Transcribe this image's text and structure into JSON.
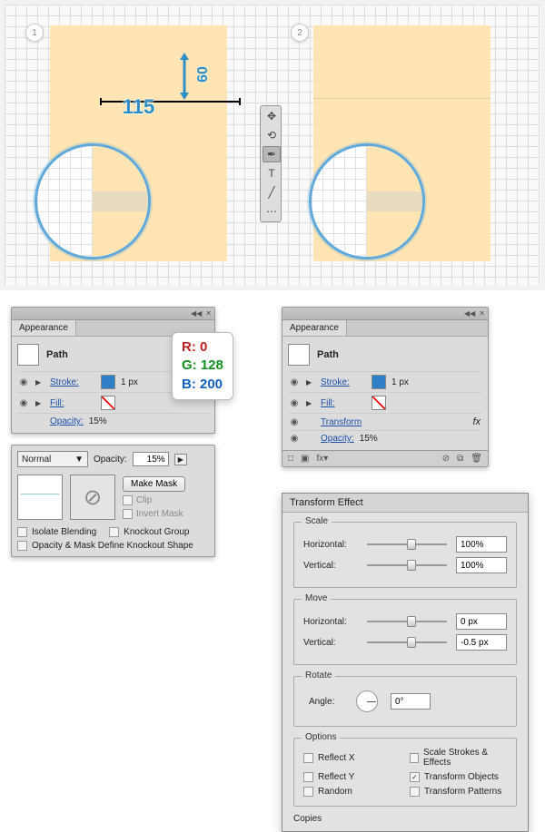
{
  "steps": {
    "one": "1",
    "two": "2"
  },
  "measure": {
    "width": "115",
    "height": "60"
  },
  "tools": [
    "arrow",
    "magic",
    "pen",
    "type",
    "line",
    "hand"
  ],
  "rgb": {
    "r_label": "R: 0",
    "g_label": "G: 128",
    "b_label": "B: 200"
  },
  "appearance_a": {
    "title": "Appearance",
    "item": "Path",
    "stroke_label": "Stroke:",
    "stroke_val": "1 px",
    "fill_label": "Fill:",
    "opacity_label": "Opacity:",
    "opacity_val": "15%"
  },
  "appearance_b": {
    "title": "Appearance",
    "item": "Path",
    "stroke_label": "Stroke:",
    "stroke_val": "1 px",
    "fill_label": "Fill:",
    "transform_label": "Transform",
    "opacity_label": "Opacity:",
    "opacity_val": "15%"
  },
  "transparency": {
    "mode": "Normal",
    "opacity_label": "Opacity:",
    "opacity_val": "15%",
    "make_mask": "Make Mask",
    "clip": "Clip",
    "invert": "Invert Mask",
    "isolate": "Isolate Blending",
    "knockout": "Knockout Group",
    "opmask": "Opacity & Mask Define Knockout Shape"
  },
  "transform": {
    "title": "Transform Effect",
    "scale": {
      "legend": "Scale",
      "h_label": "Horizontal:",
      "h_val": "100%",
      "v_label": "Vertical:",
      "v_val": "100%"
    },
    "move": {
      "legend": "Move",
      "h_label": "Horizontal:",
      "h_val": "0 px",
      "v_label": "Vertical:",
      "v_val": "-0.5 px"
    },
    "rotate": {
      "legend": "Rotate",
      "a_label": "Angle:",
      "a_val": "0°"
    },
    "options": {
      "legend": "Options",
      "reflect_x": "Reflect X",
      "reflect_y": "Reflect Y",
      "random": "Random",
      "scale_strokes": "Scale Strokes & Effects",
      "transform_objects": "Transform Objects",
      "transform_patterns": "Transform Patterns"
    },
    "copies_label": "Copies"
  }
}
